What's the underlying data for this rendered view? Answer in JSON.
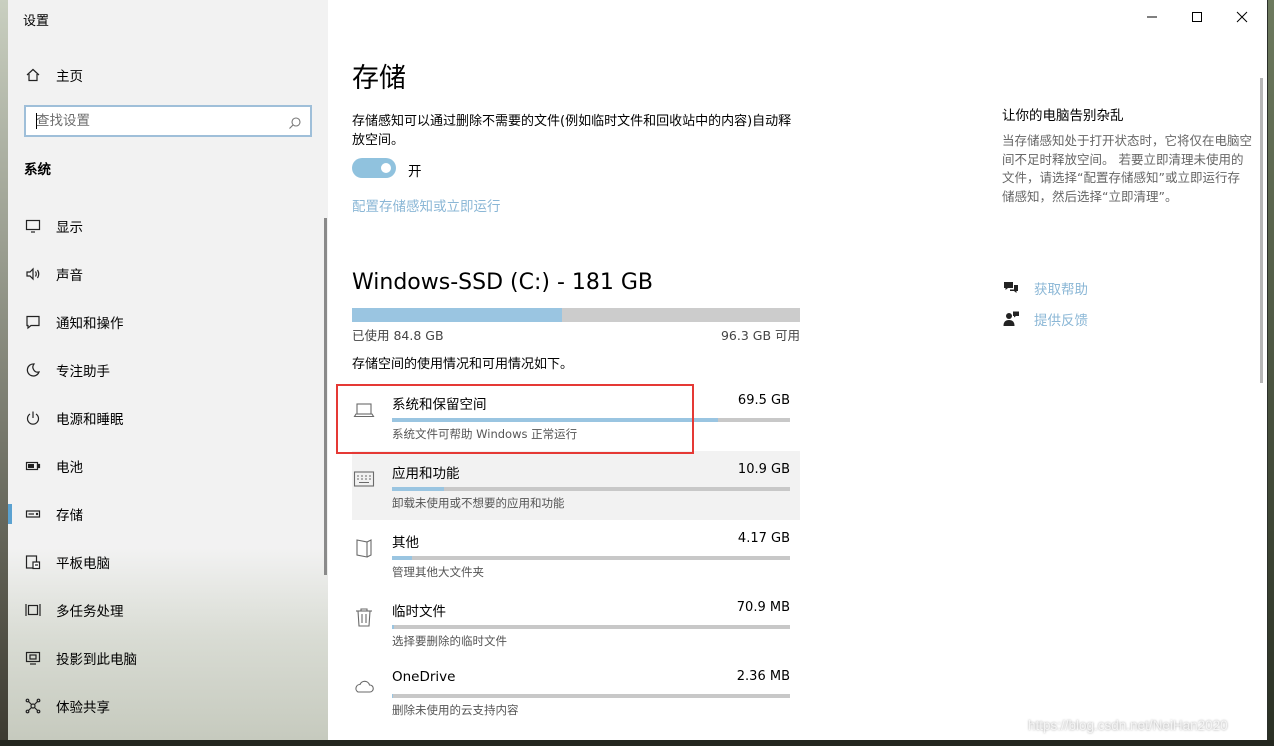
{
  "window": {
    "title": "设置",
    "controls": {
      "minimize": "minimize-icon",
      "maximize": "maximize-icon",
      "close": "close-icon"
    }
  },
  "sidebar": {
    "home_label": "主页",
    "search_placeholder": "查找设置",
    "section_title": "系统",
    "items": [
      {
        "label": "显示",
        "icon": "monitor-icon"
      },
      {
        "label": "声音",
        "icon": "speaker-icon"
      },
      {
        "label": "通知和操作",
        "icon": "notification-icon"
      },
      {
        "label": "专注助手",
        "icon": "moon-icon"
      },
      {
        "label": "电源和睡眠",
        "icon": "power-icon"
      },
      {
        "label": "电池",
        "icon": "battery-icon"
      },
      {
        "label": "存储",
        "icon": "storage-icon",
        "active": true
      },
      {
        "label": "平板电脑",
        "icon": "tablet-icon"
      },
      {
        "label": "多任务处理",
        "icon": "multitask-icon"
      },
      {
        "label": "投影到此电脑",
        "icon": "project-icon"
      },
      {
        "label": "体验共享",
        "icon": "share-icon"
      }
    ]
  },
  "main": {
    "title": "存储",
    "description": "存储感知可以通过删除不需要的文件(例如临时文件和回收站中的内容)自动释放空间。",
    "toggle": {
      "state": "on",
      "label": "开"
    },
    "config_link": "配置存储感知或立即运行",
    "drive": {
      "title": "Windows-SSD (C:) - 181 GB",
      "used_fraction": 0.468,
      "used_label": "已使用 84.8 GB",
      "free_label": "96.3 GB 可用"
    },
    "usage_description": "存储空间的使用情况和可用情况如下。",
    "categories": [
      {
        "name": "系统和保留空间",
        "size": "69.5 GB",
        "fraction": 0.82,
        "sub": "系统文件可帮助 Windows 正常运行",
        "icon": "laptop-icon"
      },
      {
        "name": "应用和功能",
        "size": "10.9 GB",
        "fraction": 0.13,
        "sub": "卸载未使用或不想要的应用和功能",
        "icon": "keyboard-icon"
      },
      {
        "name": "其他",
        "size": "4.17 GB",
        "fraction": 0.05,
        "sub": "管理其他大文件夹",
        "icon": "file-icon"
      },
      {
        "name": "临时文件",
        "size": "70.9 MB",
        "fraction": 0.005,
        "sub": "选择要删除的临时文件",
        "icon": "trash-icon"
      },
      {
        "name": "OneDrive",
        "size": "2.36 MB",
        "fraction": 0.002,
        "sub": "删除未使用的云支持内容",
        "icon": "cloud-icon"
      }
    ]
  },
  "aside": {
    "title": "让你的电脑告别杂乱",
    "text": "当存储感知处于打开状态时，它将仅在电脑空间不足时释放空间。 若要立即清理未使用的文件，请选择“配置存储感知”或立即运行存储感知，然后选择“立即清理”。",
    "help_link": "获取帮助",
    "feedback_link": "提供反馈"
  },
  "watermark": "https://blog.csdn.net/NeiHan2020",
  "colors": {
    "accent": "#9ac5e1",
    "link": "#8bb7d6",
    "highlight_box": "#e53935",
    "sidebar_bg": "#f2f2f2"
  }
}
